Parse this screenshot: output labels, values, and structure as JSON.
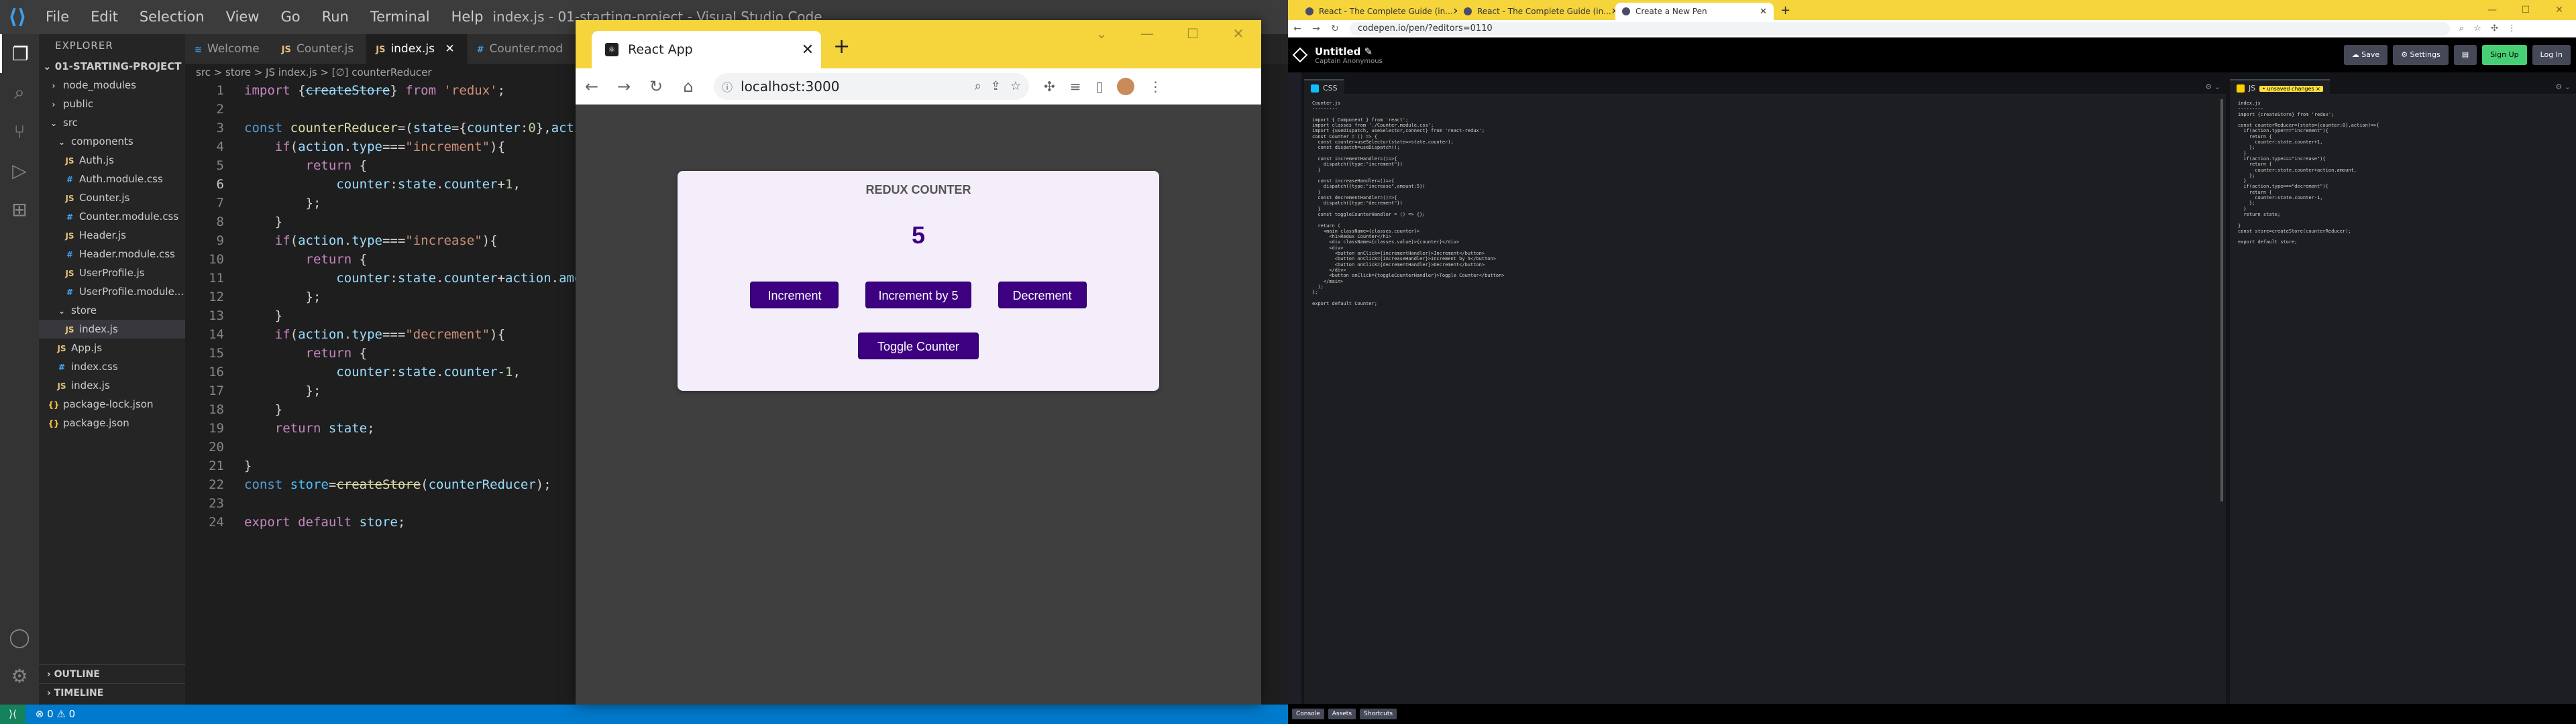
{
  "vscode": {
    "menu": [
      "File",
      "Edit",
      "Selection",
      "View",
      "Go",
      "Run",
      "Terminal",
      "Help"
    ],
    "window_title": "index.js - 01-starting-project - Visual Studio Code",
    "explorer_label": "EXPLORER",
    "project": "01-STARTING-PROJECT",
    "tree": [
      {
        "label": "node_modules",
        "type": "dir",
        "indent": 1,
        "arrow": "›"
      },
      {
        "label": "public",
        "type": "dir",
        "indent": 1,
        "arrow": "›"
      },
      {
        "label": "src",
        "type": "dir",
        "indent": 1,
        "arrow": "⌄"
      },
      {
        "label": "components",
        "type": "dir",
        "indent": 2,
        "arrow": "⌄"
      },
      {
        "label": "Auth.js",
        "type": "js",
        "indent": 3
      },
      {
        "label": "Auth.module.css",
        "type": "css",
        "indent": 3
      },
      {
        "label": "Counter.js",
        "type": "js",
        "indent": 3
      },
      {
        "label": "Counter.module.css",
        "type": "css",
        "indent": 3
      },
      {
        "label": "Header.js",
        "type": "js",
        "indent": 3
      },
      {
        "label": "Header.module.css",
        "type": "css",
        "indent": 3
      },
      {
        "label": "UserProfile.js",
        "type": "js",
        "indent": 3
      },
      {
        "label": "UserProfile.module...",
        "type": "css",
        "indent": 3
      },
      {
        "label": "store",
        "type": "dir",
        "indent": 2,
        "arrow": "⌄"
      },
      {
        "label": "index.js",
        "type": "js",
        "indent": 3,
        "selected": true
      },
      {
        "label": "App.js",
        "type": "js",
        "indent": 2
      },
      {
        "label": "index.css",
        "type": "css",
        "indent": 2
      },
      {
        "label": "index.js",
        "type": "js",
        "indent": 2
      },
      {
        "label": "package-lock.json",
        "type": "json",
        "indent": 1
      },
      {
        "label": "package.json",
        "type": "json",
        "indent": 1
      }
    ],
    "outline_label": "OUTLINE",
    "timeline_label": "TIMELINE",
    "tabs": [
      {
        "label": "Welcome",
        "icon": "≋",
        "active": false
      },
      {
        "label": "Counter.js",
        "icon": "JS",
        "active": false
      },
      {
        "label": "index.js",
        "icon": "JS",
        "active": true
      },
      {
        "label": "Counter.mod",
        "icon": "#",
        "active": false
      }
    ],
    "breadcrumb": "src > store > JS index.js > [∅] counterReducer",
    "status_left": "⊗ 0 ⚠ 0",
    "current_line": 6
  },
  "browser": {
    "tab_title": "React App",
    "url": "localhost:3000"
  },
  "redux_app": {
    "title": "REDUX COUNTER",
    "counter_value": "5",
    "increment_label": "Increment",
    "increment5_label": "Increment by 5",
    "decrement_label": "Decrement",
    "toggle_label": "Toggle Counter"
  },
  "chrome2": {
    "tabs": [
      {
        "label": "React - The Complete Guide (in...",
        "active": false
      },
      {
        "label": "React - The Complete Guide (in...",
        "active": false
      },
      {
        "label": "Create a New Pen",
        "active": true
      }
    ],
    "url": "codepen.io/pen/?editors=0110"
  },
  "codepen": {
    "title": "Untitled ✎",
    "subtitle": "Captain Anonymous",
    "save_label": "☁ Save",
    "settings_label": "⚙ Settings",
    "signup_label": "Sign Up",
    "login_label": "Log In",
    "css_tab": "CSS",
    "js_tab": "JS",
    "js_unsaved": "• unsaved changes ×",
    "footer": [
      "Console",
      "Assets",
      "Shortcuts"
    ]
  },
  "css_panel_lines": [
    "Counter.js",
    "---------",
    "",
    "import { Component } from 'react';",
    "import classes from './Counter.module.css';",
    "import {useDispatch, useSelector,connect} from 'react-redux';",
    "const Counter = () => {",
    "  const counter=useSelector(state=>state.counter);",
    "  const dispatch=useDispatch();",
    "",
    "  const incrementHandler=()=>{",
    "    dispatch({type:\"increment\"})",
    "  }",
    "",
    "  const increaseHandler=()=>{",
    "    dispatch({type:\"increase\",amount:5})",
    "  }",
    "  const decrementHandler=()=>{",
    "    dispatch({type:\"decrement\"})",
    "  }",
    "  const toggleCounterHandler = () => {};",
    "",
    "  return (",
    "    <main className={classes.counter}>",
    "      <h1>Redux Counter</h1>",
    "      <div className={classes.value}>{counter}</div>",
    "      <div>",
    "        <button onClick={incrementHandler}>Increment</button>",
    "        <button onClick={increaseHandler}>Increment by 5</button>",
    "        <button onClick={decrementHandler}>Decrement</button>",
    "      </div>",
    "      <button onClick={toggleCounterHandler}>Toggle Counter</button>",
    "    </main>",
    "  );",
    "};",
    "",
    "export default Counter;"
  ],
  "js_panel_lines": [
    "index.js",
    "---------",
    "import {createStore} from 'redux';",
    "",
    "const counterReducer=(state={counter:0},action)=>{",
    "  if(action.type===\"increment\"){",
    "    return {",
    "      counter:state.counter+1,",
    "    };",
    "  }",
    "  if(action.type===\"increase\"){",
    "    return {",
    "      counter:state.counter+action.amount,",
    "    };",
    "  }",
    "  if(action.type===\"decrement\"){",
    "    return {",
    "      counter:state.counter-1,",
    "    };",
    "  }",
    "  return state;",
    "",
    "}",
    "const store=createStore(counterReducer);",
    "",
    "export default store;"
  ]
}
